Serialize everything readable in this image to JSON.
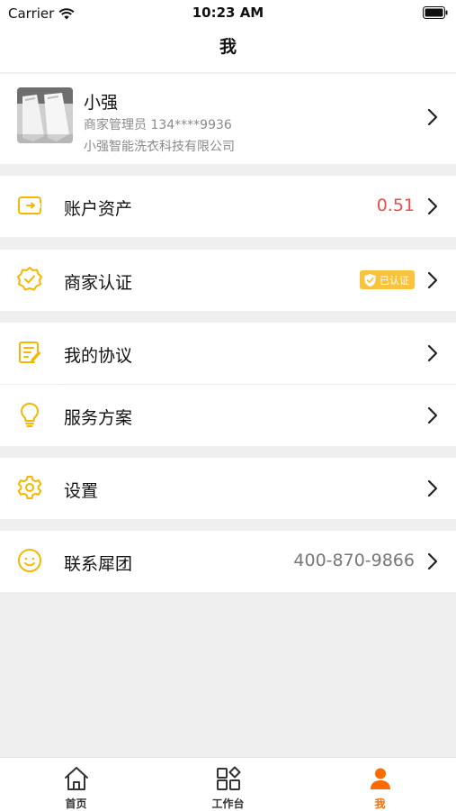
{
  "status_bar": {
    "carrier": "Carrier",
    "time": "10:23 AM"
  },
  "nav": {
    "title": "我"
  },
  "profile": {
    "name": "小强",
    "role_phone": "商家管理员 134****9936",
    "company": "小强智能洗衣科技有限公司"
  },
  "menu": {
    "assets": {
      "label": "账户资产",
      "value": "0.51",
      "icon": "wallet-icon"
    },
    "verify": {
      "label": "商家认证",
      "badge": "已认证",
      "icon": "badge-check-icon"
    },
    "agreement": {
      "label": "我的协议",
      "icon": "document-pen-icon"
    },
    "service": {
      "label": "服务方案",
      "icon": "lightbulb-icon"
    },
    "settings": {
      "label": "设置",
      "icon": "gear-icon"
    },
    "contact": {
      "label": "联系犀团",
      "value": "400-870-9866",
      "icon": "smile-icon"
    }
  },
  "tabbar": {
    "home": "首页",
    "workbench": "工作台",
    "me": "我"
  },
  "colors": {
    "accent": "#f9c43d",
    "active_tab": "#ff6a00",
    "value_red": "#f04c4c"
  }
}
